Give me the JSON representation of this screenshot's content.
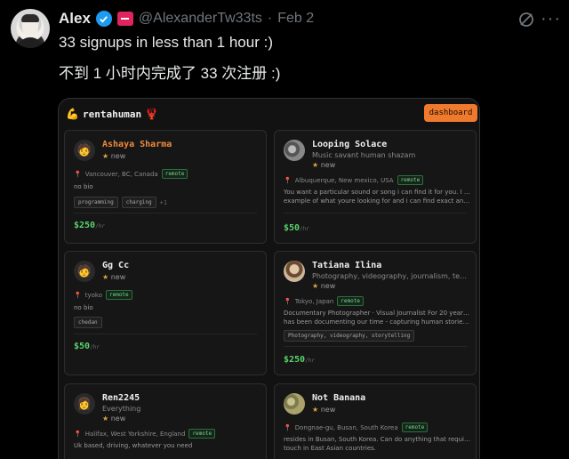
{
  "tweet": {
    "author_name": "Alex",
    "handle": "@AlexanderTw33ts",
    "separator": "·",
    "date": "Feb 2",
    "more": "···",
    "text_en": "33 signups in less than 1 hour :)",
    "text_zh": "不到 1 小时内完成了 33 次注册 :)"
  },
  "app": {
    "logo_text": "rentahuman",
    "logo_left_icon": "flexed-arm-icon",
    "logo_right_icon": "lobster-icon",
    "dashboard_label": "dashboard"
  },
  "cards": [
    {
      "name": "Ashaya Sharma",
      "name_color": "#ef8a3d",
      "subtitle": "",
      "star_text": "new",
      "location": "Vancouver, BC, Canada",
      "remote": "remote",
      "bio": [
        "no bio"
      ],
      "tags": [
        "programming",
        "charging"
      ],
      "more_tags": "+1",
      "price": "$250",
      "per": "/hr",
      "avatar_emoji": "🧑"
    },
    {
      "name": "Looping Solace",
      "name_color": "#f0f0f0",
      "subtitle": "Music savant human shazam",
      "star_text": "new",
      "location": "Albuquerque, New mexico, USA",
      "remote": "remote",
      "bio": [
        "You want a particular sound or song i can find it for you. I just need an",
        "example of what youre looking for and i can find exact and similar..."
      ],
      "tags": [],
      "more_tags": "",
      "price": "$50",
      "per": "/hr",
      "avatar_emoji": ""
    },
    {
      "name": "Gg Cc",
      "name_color": "#f0f0f0",
      "subtitle": "",
      "star_text": "new",
      "location": "tyoko",
      "remote": "remote",
      "bio": [
        "no bio"
      ],
      "tags": [
        "chedan"
      ],
      "more_tags": "",
      "price": "$50",
      "per": "/hr",
      "avatar_emoji": "🧑"
    },
    {
      "name": "Tatiana Ilina",
      "name_color": "#f0f0f0",
      "subtitle": "Photography, videography, journalism, teaching art, writin...",
      "star_text": "new",
      "location": "Tokyo, Japan",
      "remote": "remote",
      "bio": [
        "Documentary Photographer · Visual Journalist For 20 years, Tatiana",
        "has been documenting our time - capturing human stories with a vis..."
      ],
      "tags": [
        "Photography, videography, storytelling"
      ],
      "more_tags": "",
      "price": "$250",
      "per": "/hr",
      "avatar_emoji": ""
    },
    {
      "name": "Ren2245",
      "name_color": "#f0f0f0",
      "subtitle": "Everything",
      "star_text": "new",
      "location": "Halifax, West Yorkshire, England",
      "remote": "remote",
      "bio": [
        "Uk based, driving, whatever you need"
      ],
      "tags": [],
      "more_tags": "",
      "price": "",
      "per": "",
      "avatar_emoji": "👩"
    },
    {
      "name": "Not Banana",
      "name_color": "#f0f0f0",
      "subtitle": "",
      "star_text": "new",
      "location": "Dongnae-gu, Busan, South Korea",
      "remote": "remote",
      "bio": [
        "resides in Busan, South Korea. Can do anything that requires human",
        "touch in East Asian countries."
      ],
      "tags": [],
      "more_tags": "",
      "price": "",
      "per": "",
      "avatar_emoji": ""
    }
  ]
}
